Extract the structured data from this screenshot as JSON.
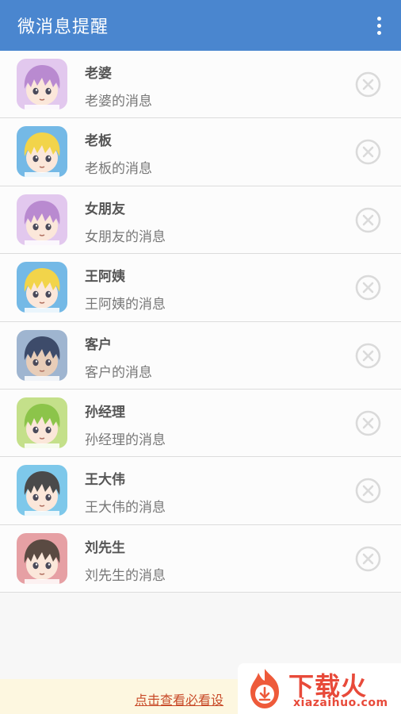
{
  "app_bar": {
    "title": "微消息提醒",
    "menu_icon": "more-vert-icon"
  },
  "contacts": [
    {
      "name": "老婆",
      "message": "老婆的消息",
      "avatar": "avatar-purple-hair-icon",
      "avatar_bg": "#e2c8ee",
      "hair": "#b98ad0",
      "skin": "#fbe7da"
    },
    {
      "name": "老板",
      "message": "老板的消息",
      "avatar": "avatar-yellow-hair-icon",
      "avatar_bg": "#74b9e6",
      "hair": "#f2d44a",
      "skin": "#fbe7da"
    },
    {
      "name": "女朋友",
      "message": "女朋友的消息",
      "avatar": "avatar-purple-hair-icon",
      "avatar_bg": "#e2c8ee",
      "hair": "#b98ad0",
      "skin": "#fbe7da"
    },
    {
      "name": "王阿姨",
      "message": "王阿姨的消息",
      "avatar": "avatar-yellow-hair-icon",
      "avatar_bg": "#74b9e6",
      "hair": "#f2d44a",
      "skin": "#fbe7da"
    },
    {
      "name": "客户",
      "message": "客户的消息",
      "avatar": "avatar-navy-hair-icon",
      "avatar_bg": "#9fb5d0",
      "hair": "#3d4b6a",
      "skin": "#e8cdb8"
    },
    {
      "name": "孙经理",
      "message": "孙经理的消息",
      "avatar": "avatar-green-hair-icon",
      "avatar_bg": "#c4e08a",
      "hair": "#8cc44a",
      "skin": "#fbe7da"
    },
    {
      "name": "王大伟",
      "message": "王大伟的消息",
      "avatar": "avatar-dark-hair-icon",
      "avatar_bg": "#7ec8ea",
      "hair": "#4a4a4a",
      "skin": "#fbe7da"
    },
    {
      "name": "刘先生",
      "message": "刘先生的消息",
      "avatar": "avatar-brown-hair-icon",
      "avatar_bg": "#e6a0a4",
      "hair": "#5a4a42",
      "skin": "#fbe7da"
    }
  ],
  "delete_icon": "close-circle-icon",
  "footer": {
    "link_text": "点击查看必看设"
  },
  "watermark": {
    "name": "下载火",
    "url": "xiazaihuo.com",
    "logo": "flame-download-icon"
  },
  "colors": {
    "accent": "#4a86cf",
    "footer_link": "#c84a28",
    "watermark": "#e84a3a"
  }
}
